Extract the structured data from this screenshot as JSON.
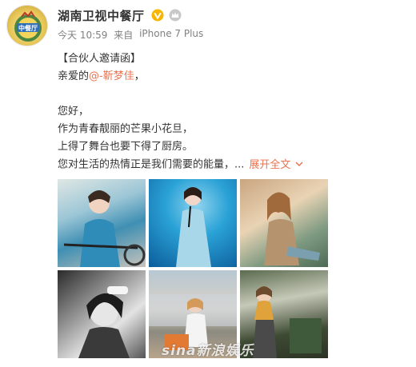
{
  "account": {
    "name": "湖南卫视中餐厅",
    "avatar_text": "中餐厅",
    "verified_icon": "verified-v-icon",
    "member_icon": "crown-member-icon"
  },
  "post": {
    "meta": {
      "time": "今天 10:59",
      "source_prefix": "来自",
      "source": "iPhone 7 Plus"
    },
    "lines": {
      "l1": "【合伙人邀请函】",
      "l2_prefix": "亲爱的",
      "mention": "@-靳梦佳",
      "l2_suffix": "，",
      "l3": "您好，",
      "l4": "作为青春靓丽的芒果小花旦，",
      "l5": "上得了舞台也要下得了厨房。",
      "l6": "您对生活的热情正是我们需要的能量，..."
    },
    "expand_label": "展开全文",
    "expand_icon": "chevron-down-icon"
  },
  "images": {
    "watermark": "sina新浪娱乐"
  },
  "colors": {
    "link": "#eb7350",
    "meta": "#808080",
    "verified": "#f7b500"
  }
}
